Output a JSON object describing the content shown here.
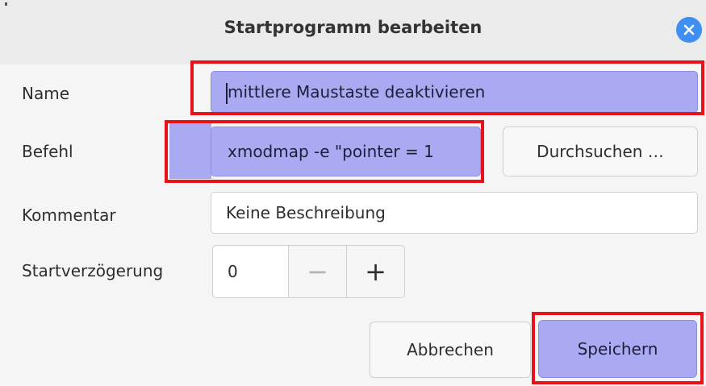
{
  "window": {
    "title": "Startprogramm bearbeiten",
    "close_icon": "close-icon"
  },
  "form": {
    "name_label": "Name",
    "name_value": "mittlere Maustaste deaktivieren",
    "command_label": "Befehl",
    "command_value": "xmodmap -e \"pointer = 1",
    "browse_label": "Durchsuchen …",
    "comment_label": "Kommentar",
    "comment_value": "Keine Beschreibung",
    "delay_label": "Startverzögerung",
    "delay_value": "0",
    "minus_symbol": "−",
    "plus_symbol": "+"
  },
  "actions": {
    "cancel_label": "Abbrechen",
    "save_label": "Speichern"
  },
  "colors": {
    "accent": "#aaaaf2",
    "highlight": "#e8121b",
    "close": "#3f8ef2"
  }
}
